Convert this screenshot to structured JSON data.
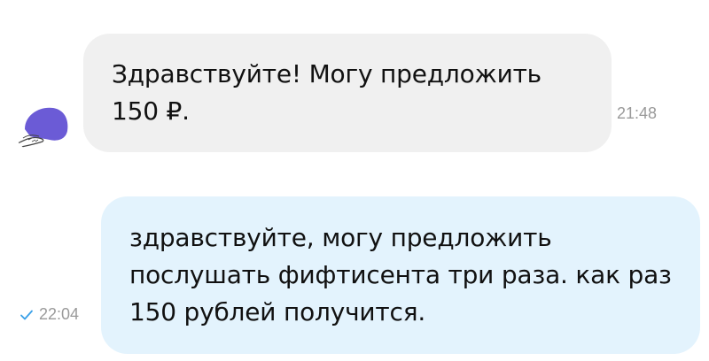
{
  "messages": [
    {
      "direction": "incoming",
      "text": "Здравствуйте! Могу предложить\n150 ₽.",
      "time": "21:48"
    },
    {
      "direction": "outgoing",
      "text": "здравствуйте, могу предложить\nпослушать фифтисента три раза. как раз\n150 рублей получится.",
      "time": "22:04",
      "status": "sent"
    }
  ],
  "colors": {
    "incoming_bubble": "#f0f0f0",
    "outgoing_bubble": "#e3f3fd",
    "timestamp": "#9a9a9a",
    "check": "#3aa0e8",
    "avatar_accent": "#6b5bd6"
  },
  "icons": {
    "avatar": "avatar-hand-holding-purple-shape",
    "status": "single-check-icon"
  }
}
